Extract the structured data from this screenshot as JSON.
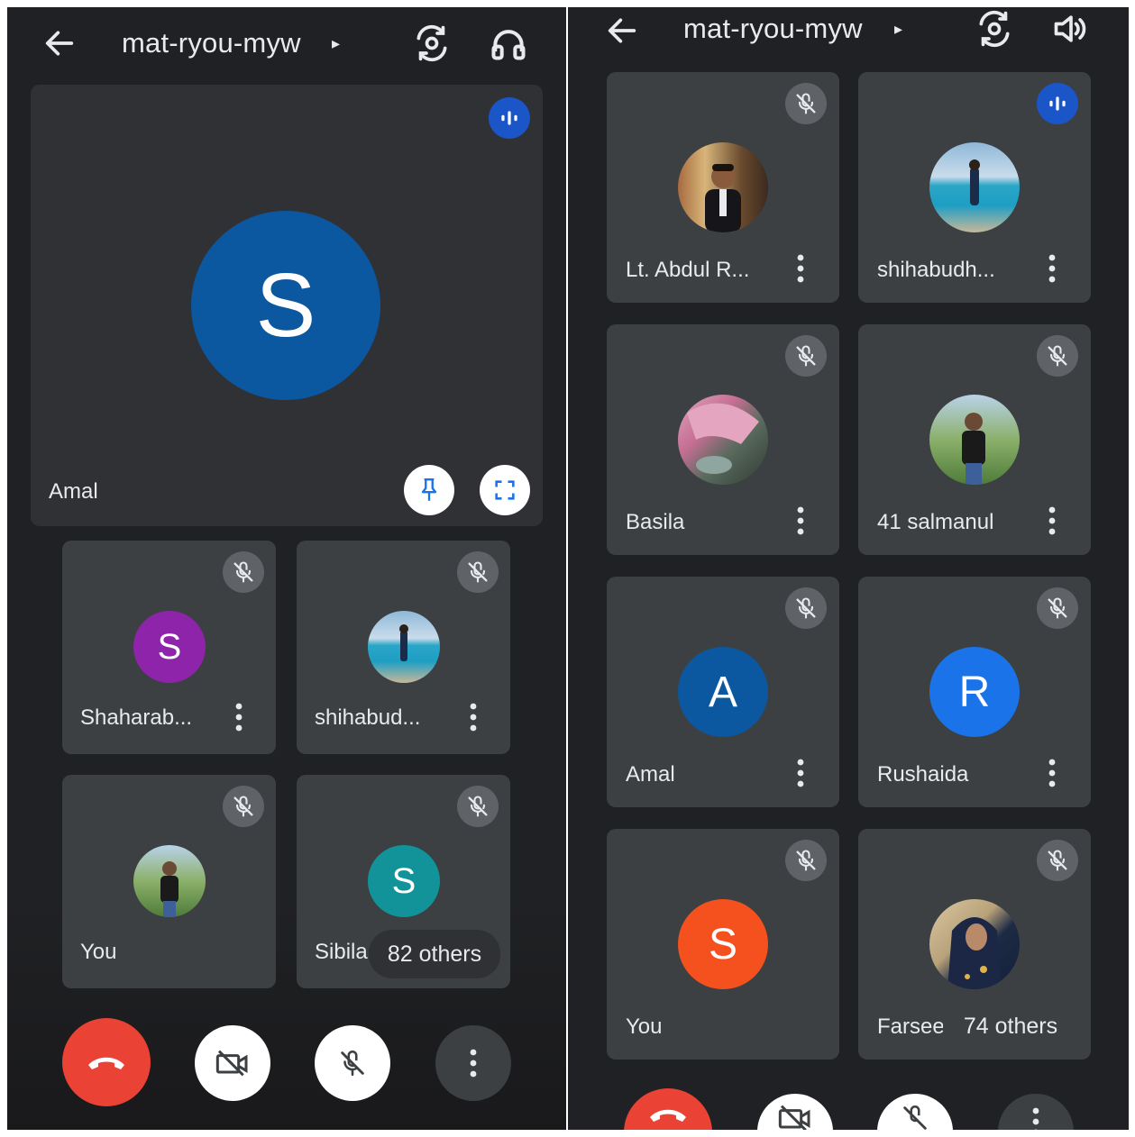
{
  "left": {
    "header": {
      "meeting_code": "mat-ryou-myw",
      "chevron": "▸",
      "icons": [
        "back-arrow-icon",
        "switch-camera-icon",
        "headphones-icon"
      ]
    },
    "main_tile": {
      "name": "Amal",
      "avatar_letter": "S",
      "avatar_color": "#0b57a0",
      "icons": [
        "speaking-indicator-icon",
        "pin-icon",
        "fullscreen-icon"
      ]
    },
    "tiles": [
      {
        "name": "Shaharab...",
        "avatar_letter": "S",
        "avatar_color": "#8e24aa",
        "muted": true
      },
      {
        "name": "shihabud...",
        "avatar_letter": "",
        "avatar_photo": "pool-photo",
        "muted": true
      },
      {
        "name": "You",
        "avatar_letter": "",
        "avatar_photo": "person-outdoor-photo",
        "muted": true
      },
      {
        "name": "Sibila",
        "avatar_letter": "S",
        "avatar_color": "#12939a",
        "muted": true,
        "others": "82 others"
      }
    ],
    "controls": [
      "end-call-button",
      "camera-off-button",
      "mic-off-button",
      "more-options-button"
    ]
  },
  "right": {
    "header": {
      "meeting_code": "mat-ryou-myw",
      "chevron": "▸",
      "icons": [
        "back-arrow-icon",
        "switch-camera-icon",
        "speaker-icon"
      ]
    },
    "tiles": [
      {
        "name": "Lt. Abdul R...",
        "avatar_letter": "",
        "avatar_photo": "office-photo",
        "muted": true
      },
      {
        "name": "shihabudh...",
        "avatar_letter": "",
        "avatar_photo": "pool-photo",
        "speaking": true
      },
      {
        "name": "Basila",
        "avatar_letter": "",
        "avatar_photo": "pink-scarf-photo",
        "muted": true
      },
      {
        "name": "41 salmanul",
        "avatar_letter": "",
        "avatar_photo": "person-outdoor-photo",
        "muted": true
      },
      {
        "name": "Amal",
        "avatar_letter": "A",
        "avatar_color": "#0b57a0",
        "muted": true
      },
      {
        "name": "Rushaida",
        "avatar_letter": "R",
        "avatar_color": "#1a73e8",
        "muted": true
      },
      {
        "name": "You",
        "avatar_letter": "S",
        "avatar_color": "#f4511e",
        "muted": true
      },
      {
        "name": "Farseen",
        "avatar_letter": "",
        "avatar_photo": "woman-scarf-photo",
        "muted": true,
        "others": "74 others"
      }
    ],
    "controls": [
      "end-call-button",
      "camera-off-button",
      "mic-off-button",
      "more-options-button"
    ]
  },
  "colors": {
    "background": "#202124",
    "tile": "#3c4043",
    "end_call": "#ea4335",
    "mute_badge": "#5f6368",
    "speaking_badge": "#1a56c8"
  }
}
